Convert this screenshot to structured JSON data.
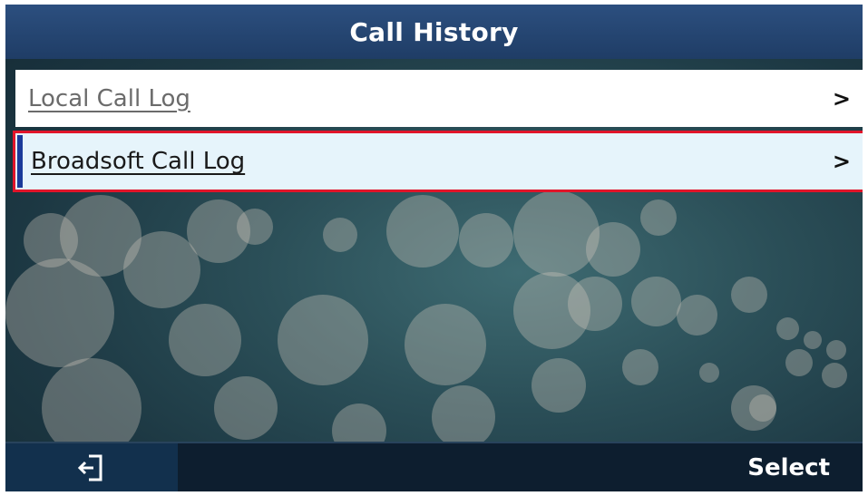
{
  "header": {
    "title": "Call History"
  },
  "menu": {
    "items": [
      {
        "label": "Local Call Log",
        "chevron": ">"
      },
      {
        "label": "Broadsoft Call Log",
        "chevron": ">",
        "selected": true
      }
    ]
  },
  "softkeys": {
    "back_icon": "exit-icon",
    "select_label": "Select"
  },
  "colors": {
    "title_bar": "#24466f",
    "selected_row": "#e6f4fb",
    "highlight_border": "#e0152a",
    "softkey_bar": "#0d1e2f"
  }
}
